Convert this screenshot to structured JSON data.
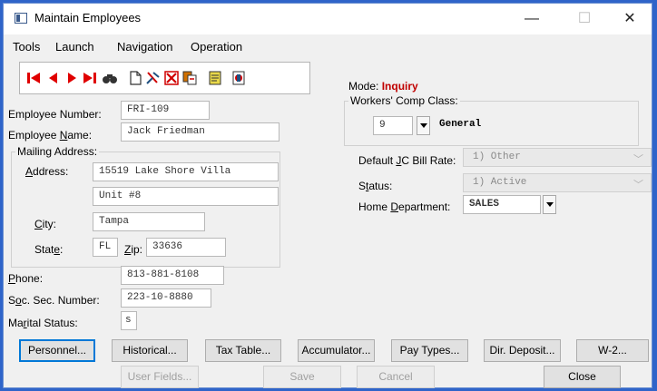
{
  "window": {
    "title": "Maintain Employees",
    "minimize_glyph": "—",
    "maximize_glyph": "☐",
    "close_glyph": "✕"
  },
  "menu": [
    "Tools",
    "Launch",
    "Navigation",
    "Operation"
  ],
  "toolbar": {
    "icons": [
      "first-record-icon",
      "previous-record-icon",
      "next-record-icon",
      "last-record-icon",
      "find-icon",
      "new-record-icon",
      "delete-icon",
      "cancel-icon",
      "copy-icon",
      "notes-icon",
      "print-icon"
    ],
    "find_glyph": "🔭"
  },
  "mode": {
    "label": "Mode:",
    "value": "Inquiry"
  },
  "workers_comp": {
    "title": "Workers' Comp Class:",
    "code": "9",
    "description": "General"
  },
  "employee": {
    "number_label": "Employee Number:",
    "number": "FRI-109",
    "name_label_pre": "Employee ",
    "name_label_acc": "N",
    "name_label_post": "ame:",
    "name": "Jack Friedman"
  },
  "address": {
    "group_title": "Mailing Address:",
    "address_label_acc": "A",
    "address_label_post": "ddress:",
    "line1": "15519 Lake Shore Villa",
    "line2": "Unit #8",
    "city_label_acc": "C",
    "city_label_post": "ity:",
    "city": "Tampa",
    "state_label_pre": "Stat",
    "state_label_acc": "e",
    "state_label_post": ":",
    "state": "FL",
    "zip_label_acc": "Z",
    "zip_label_post": "ip:",
    "zip": "33636"
  },
  "phone": {
    "label_acc": "P",
    "label_post": "hone:",
    "value": "813-881-8108"
  },
  "ssn": {
    "label_pre": "S",
    "label_acc": "o",
    "label_post": "c. Sec. Number:",
    "value": "223-10-8880"
  },
  "marital": {
    "label_pre": "Ma",
    "label_acc": "r",
    "label_post": "ital Status:",
    "value": "s"
  },
  "bill_rate": {
    "label_pre": "Default ",
    "label_acc": "J",
    "label_post": "C Bill Rate:",
    "value": "1) Other"
  },
  "status": {
    "label_pre": "S",
    "label_acc": "t",
    "label_post": "atus:",
    "value": "1) Active"
  },
  "home_dept": {
    "label_pre": "Home ",
    "label_acc": "D",
    "label_post": "epartment:",
    "value": "SALES"
  },
  "chevron_glyph": "﹀",
  "buttons_row1": [
    "Personnel...",
    "Historical...",
    "Tax Table...",
    "Accumulator...",
    "Pay Types...",
    "Dir. Deposit...",
    "W-2..."
  ],
  "buttons_row2": {
    "user_fields": "User Fields...",
    "save": "Save",
    "cancel": "Cancel",
    "close": "Close"
  }
}
